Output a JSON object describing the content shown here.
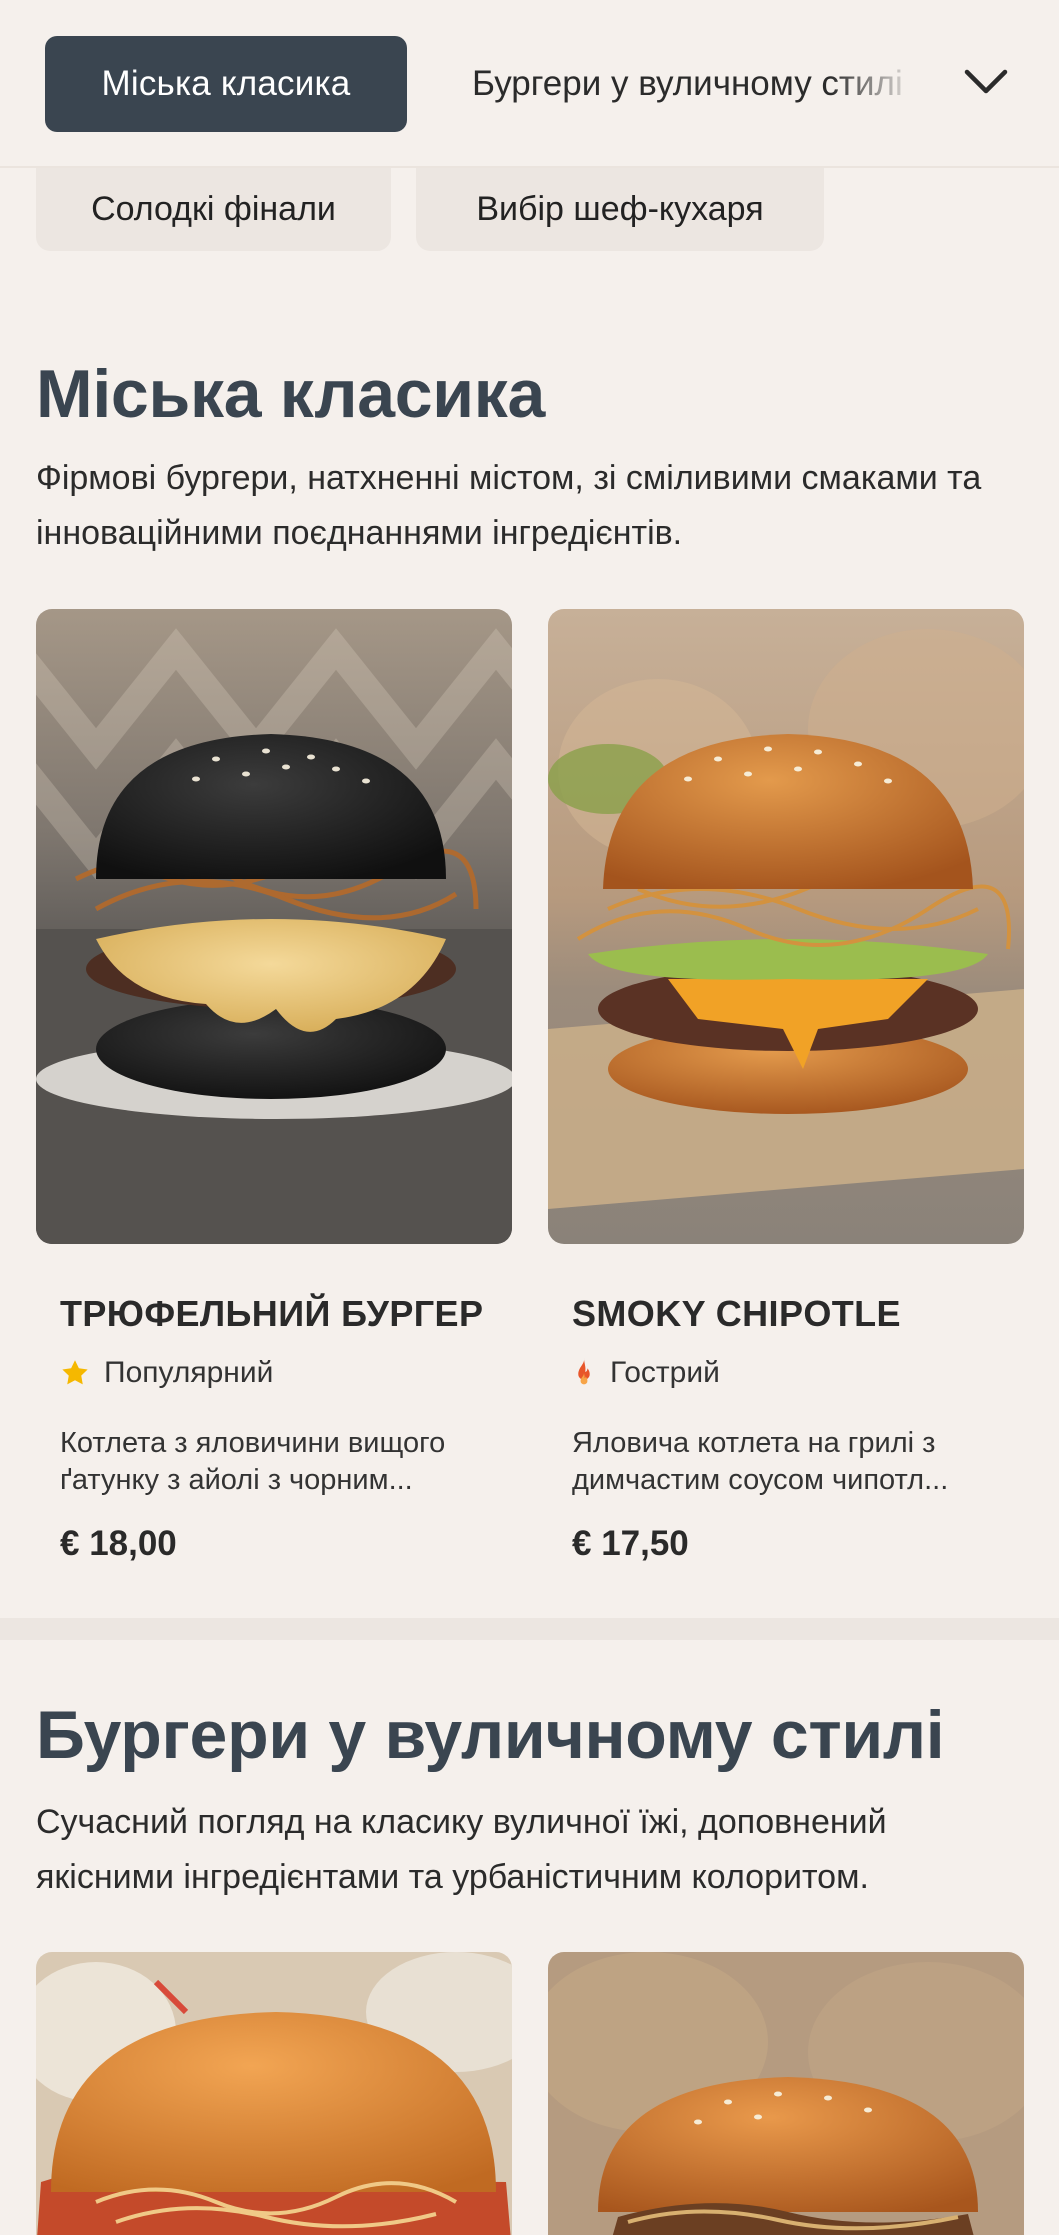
{
  "category_nav": {
    "active": "Міська класика",
    "next": "Бургери у вуличному стилі",
    "chips": [
      "Солодкі фінали",
      "Вибір шеф-кухаря"
    ]
  },
  "sections": [
    {
      "title": "Міська класика",
      "description": "Фірмові бургери, натхненні містом, зі сміливими смаками та інноваційними поєднаннями інгредієнтів.",
      "products": [
        {
          "name": "ТРЮФЕЛЬНИЙ БУРГЕР",
          "tag": "Популярний",
          "tag_icon": "star-icon",
          "description_line1": "Котлета з яловичини вищого",
          "description_line2": "ґатунку з айолі з чорним...",
          "price": "€ 18,00"
        },
        {
          "name": "SMOKY CHIPOTLE",
          "tag": "Гострий",
          "tag_icon": "flame-icon",
          "description_line1": "Яловича котлета на грилі з",
          "description_line2": "димчастим соусом чипотл...",
          "price": "€ 17,50"
        }
      ]
    },
    {
      "title": "Бургери у вуличному стилі",
      "description": "Сучасний погляд на класику вуличної їжі, доповнений якісними інгредієнтами та урбаністичним колоритом."
    }
  ],
  "colors": {
    "background": "#f5f0ec",
    "active_chip": "#3a4550",
    "heading": "#3a4550",
    "star": "#f5b800",
    "flame": "#e8562a"
  }
}
